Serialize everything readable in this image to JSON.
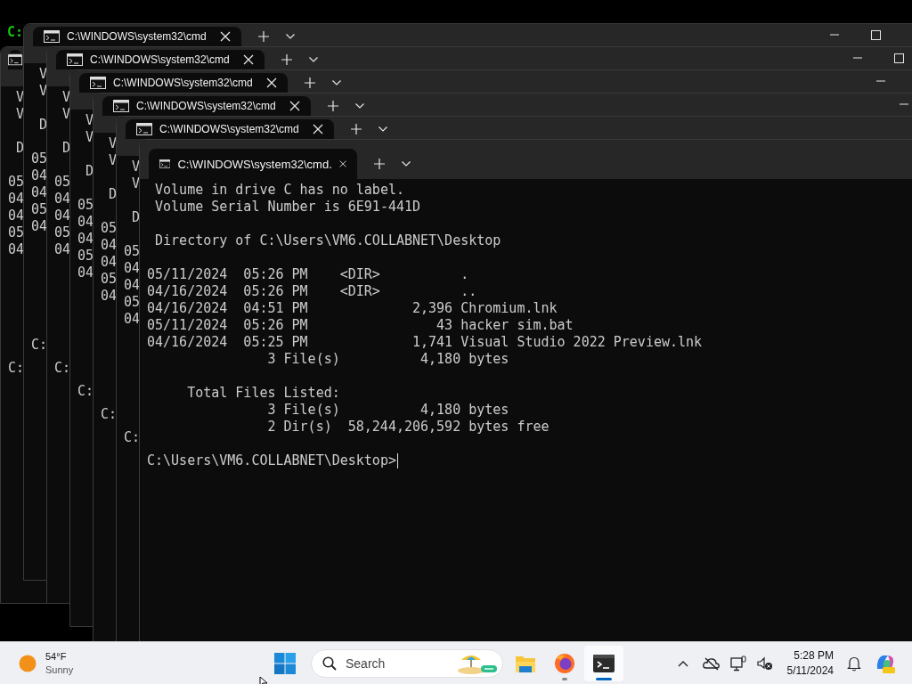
{
  "background_prompt": {
    "text": "C:"
  },
  "windows": [
    {
      "lines": [
        {
          "kind": "note",
          "text": "V"
        },
        {
          "kind": "note",
          "text": "V"
        },
        {
          "kind": "heading",
          "text": "D"
        },
        {
          "kind": "entry",
          "date": "05"
        },
        {
          "kind": "entry",
          "date": "04"
        },
        {
          "kind": "entry",
          "date": "04"
        },
        {
          "kind": "entry",
          "date": "05"
        },
        {
          "kind": "entry",
          "date": "04"
        },
        {
          "kind": "summary"
        },
        {
          "kind": "section"
        },
        {
          "kind": "summary"
        },
        {
          "kind": "summary"
        },
        {
          "kind": "prompt",
          "text": "C:"
        }
      ]
    },
    {
      "title": "C:\\WINDOWS\\system32\\cmd",
      "controls": [
        {
          "kind": "minimize"
        },
        {
          "kind": "maximize"
        }
      ],
      "lines": [
        {
          "kind": "note",
          "text": "V"
        },
        {
          "kind": "note",
          "text": "V"
        },
        {
          "kind": "heading",
          "text": "D"
        },
        {
          "kind": "entry",
          "date": "05"
        },
        {
          "kind": "entry",
          "date": "04"
        },
        {
          "kind": "entry",
          "date": "04"
        },
        {
          "kind": "entry",
          "date": "05"
        },
        {
          "kind": "entry",
          "date": "04"
        },
        {
          "kind": "summary"
        },
        {
          "kind": "section"
        },
        {
          "kind": "summary"
        },
        {
          "kind": "summary"
        },
        {
          "kind": "prompt",
          "text": "C:"
        }
      ]
    },
    {
      "title": "C:\\WINDOWS\\system32\\cmd",
      "controls": [
        {
          "kind": "minimize"
        },
        {
          "kind": "maximize"
        }
      ],
      "lines": [
        {
          "kind": "note",
          "text": "V"
        },
        {
          "kind": "note",
          "text": "V"
        },
        {
          "kind": "heading",
          "text": "D"
        },
        {
          "kind": "entry",
          "date": "05"
        },
        {
          "kind": "entry",
          "date": "04"
        },
        {
          "kind": "entry",
          "date": "04"
        },
        {
          "kind": "entry",
          "date": "05"
        },
        {
          "kind": "entry",
          "date": "04"
        },
        {
          "kind": "summary"
        },
        {
          "kind": "section"
        },
        {
          "kind": "summary"
        },
        {
          "kind": "summary"
        },
        {
          "kind": "prompt",
          "text": "C:"
        }
      ]
    },
    {
      "title": "C:\\WINDOWS\\system32\\cmd",
      "controls": [
        {
          "kind": "minimize"
        }
      ],
      "lines": [
        {
          "kind": "note",
          "text": "V"
        },
        {
          "kind": "note",
          "text": "V"
        },
        {
          "kind": "heading",
          "text": "D"
        },
        {
          "kind": "entry",
          "date": "05"
        },
        {
          "kind": "entry",
          "date": "04"
        },
        {
          "kind": "entry",
          "date": "04"
        },
        {
          "kind": "entry",
          "date": "05"
        },
        {
          "kind": "entry",
          "date": "04"
        },
        {
          "kind": "summary"
        },
        {
          "kind": "section"
        },
        {
          "kind": "summary"
        },
        {
          "kind": "summary"
        },
        {
          "kind": "prompt",
          "text": "C:"
        }
      ]
    },
    {
      "title": "C:\\WINDOWS\\system32\\cmd",
      "controls": [
        {
          "kind": "minimize"
        }
      ],
      "lines": [
        {
          "kind": "note",
          "text": "V"
        },
        {
          "kind": "note",
          "text": "V"
        },
        {
          "kind": "heading",
          "text": "D"
        },
        {
          "kind": "entry",
          "date": "05"
        },
        {
          "kind": "entry",
          "date": "04"
        },
        {
          "kind": "entry",
          "date": "04"
        },
        {
          "kind": "entry",
          "date": "05"
        },
        {
          "kind": "entry",
          "date": "04"
        },
        {
          "kind": "summary"
        },
        {
          "kind": "section"
        },
        {
          "kind": "summary"
        },
        {
          "kind": "summary"
        },
        {
          "kind": "prompt",
          "text": "C:"
        }
      ]
    },
    {
      "title": "C:\\WINDOWS\\system32\\cmd",
      "lines": [
        {
          "kind": "note",
          "text": "V"
        },
        {
          "kind": "note",
          "text": "V"
        },
        {
          "kind": "heading",
          "text": "D"
        },
        {
          "kind": "entry",
          "date": "05"
        },
        {
          "kind": "entry",
          "date": "04"
        },
        {
          "kind": "entry",
          "date": "04"
        },
        {
          "kind": "entry",
          "date": "05"
        },
        {
          "kind": "entry",
          "date": "04"
        },
        {
          "kind": "summary"
        },
        {
          "kind": "section"
        },
        {
          "kind": "summary"
        },
        {
          "kind": "summary"
        },
        {
          "kind": "prompt",
          "text": "C:"
        }
      ]
    },
    {
      "title": "C:\\WINDOWS\\system32\\cmd.",
      "lines": [
        {
          "kind": "note",
          "text": "Volume in drive C has no label."
        },
        {
          "kind": "note",
          "text": "Volume Serial Number is 6E91-441D"
        },
        {
          "kind": "heading",
          "text": "Directory of C:\\Users\\VM6.COLLABNET\\Desktop"
        },
        {
          "kind": "entry",
          "date": "05/11/2024",
          "time": "05:26 PM",
          "type": "<DIR>",
          "name": "."
        },
        {
          "kind": "entry",
          "date": "04/16/2024",
          "time": "05:26 PM",
          "type": "<DIR>",
          "name": ".."
        },
        {
          "kind": "entry",
          "date": "04/16/2024",
          "time": "04:51 PM",
          "size": "2,396",
          "name": "Chromium.lnk"
        },
        {
          "kind": "entry",
          "date": "05/11/2024",
          "time": "05:26 PM",
          "size": "43",
          "name": "hacker sim.bat"
        },
        {
          "kind": "entry",
          "date": "04/16/2024",
          "time": "05:25 PM",
          "size": "1,741",
          "name": "Visual Studio 2022 Preview.lnk"
        },
        {
          "kind": "summary",
          "count": "3 File(s)",
          "amount": "4,180",
          "unit": "bytes"
        },
        {
          "kind": "section",
          "text": "Total Files Listed:"
        },
        {
          "kind": "summary",
          "count": "3 File(s)",
          "amount": "4,180",
          "unit": "bytes"
        },
        {
          "kind": "summary",
          "count": "2 Dir(s)",
          "amount": "58,244,206,592",
          "unit": "bytes free"
        },
        {
          "kind": "prompt",
          "text": "C:\\Users\\VM6.COLLABNET\\Desktop>",
          "cursor": true
        }
      ]
    }
  ],
  "taskbar": {
    "weather": {
      "temperature": "54°F",
      "condition": "Sunny"
    },
    "search": {
      "label": "Search"
    },
    "apps": [
      {
        "kind": "files",
        "running": false,
        "selected": false
      },
      {
        "kind": "browser",
        "running": true,
        "selected": false
      },
      {
        "kind": "terminal",
        "running": true,
        "selected": true
      }
    ],
    "clock": {
      "time": "5:28 PM",
      "date": "5/11/2024"
    }
  }
}
